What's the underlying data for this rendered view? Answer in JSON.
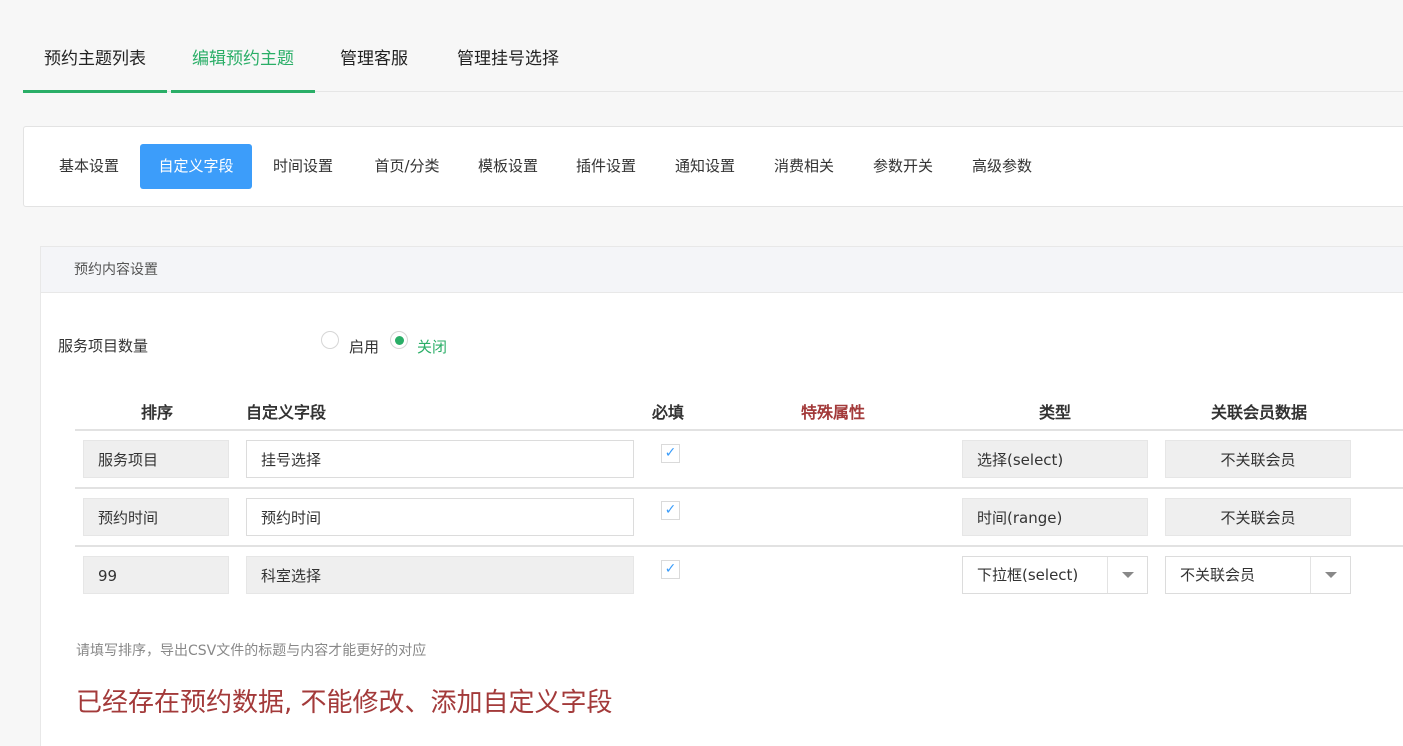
{
  "top_tabs": [
    {
      "label": "预约主题列表"
    },
    {
      "label": "编辑预约主题"
    },
    {
      "label": "管理客服"
    },
    {
      "label": "管理挂号选择"
    }
  ],
  "active_top_tab": "编辑预约主题",
  "sub_nav": [
    {
      "label": "基本设置"
    },
    {
      "label": "自定义字段"
    },
    {
      "label": "时间设置"
    },
    {
      "label": "首页/分类"
    },
    {
      "label": "模板设置"
    },
    {
      "label": "插件设置"
    },
    {
      "label": "通知设置"
    },
    {
      "label": "消费相关"
    },
    {
      "label": "参数开关"
    },
    {
      "label": "高级参数"
    }
  ],
  "active_sub_nav": "自定义字段",
  "panel": {
    "title": "预约内容设置",
    "service_count_label": "服务项目数量",
    "radio_enable": "启用",
    "radio_disable": "关闭",
    "selected_radio": "关闭"
  },
  "table": {
    "headers": {
      "sort": "排序",
      "field": "自定义字段",
      "required": "必填",
      "special": "特殊属性",
      "type": "类型",
      "member": "关联会员数据"
    },
    "rows": [
      {
        "sort": "服务项目",
        "field": "挂号选择",
        "required": true,
        "type": "选择(select)",
        "member": "不关联会员"
      },
      {
        "sort": "预约时间",
        "field": "预约时间",
        "required": true,
        "type": "时间(range)",
        "member": "不关联会员"
      },
      {
        "sort": "99",
        "field": "科室选择",
        "required": true,
        "type": "下拉框(select)",
        "member": "不关联会员"
      }
    ],
    "check_glyph": "✓"
  },
  "hint": "请填写排序，导出CSV文件的标题与内容才能更好的对应",
  "warning": "已经存在预约数据, 不能修改、添加自定义字段",
  "colors": {
    "accent_green": "#2aae67",
    "accent_blue": "#3c9dfa",
    "warning_red": "#a33a3a"
  }
}
